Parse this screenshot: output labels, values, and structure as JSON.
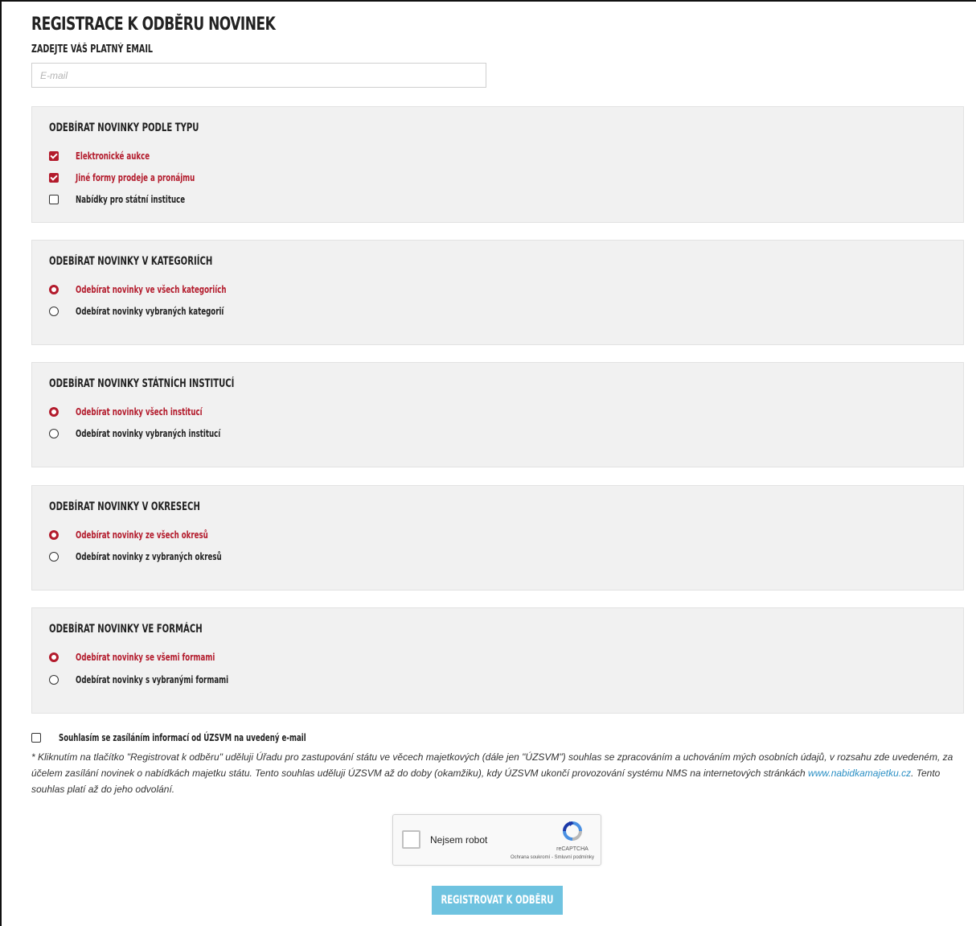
{
  "page": {
    "title": "REGISTRACE K ODBĚRU NOVINEK",
    "email_label": "ZADEJTE VÁŠ PLATNÝ EMAIL",
    "email_placeholder": "E-mail",
    "email_value": ""
  },
  "sections": [
    {
      "heading": "ODEBÍRAT NOVINKY PODLE TYPU",
      "control": "checkbox",
      "options": [
        {
          "label": "Elektronické aukce",
          "checked": true
        },
        {
          "label": "Jiné formy prodeje a pronájmu",
          "checked": true
        },
        {
          "label": "Nabídky pro státní instituce",
          "checked": false
        }
      ]
    },
    {
      "heading": "ODEBÍRAT NOVINKY V KATEGORIÍCH",
      "control": "radio",
      "options": [
        {
          "label": "Odebírat novinky ve všech kategoriích",
          "checked": true
        },
        {
          "label": "Odebírat novinky vybraných kategorií",
          "checked": false
        }
      ]
    },
    {
      "heading": "ODEBÍRAT NOVINKY STÁTNÍCH INSTITUCÍ",
      "control": "radio",
      "options": [
        {
          "label": "Odebírat novinky všech institucí",
          "checked": true
        },
        {
          "label": "Odebírat novinky vybraných institucí",
          "checked": false
        }
      ]
    },
    {
      "heading": "ODEBÍRAT NOVINKY V OKRESECH",
      "control": "radio",
      "options": [
        {
          "label": "Odebírat novinky ze všech okresů",
          "checked": true
        },
        {
          "label": "Odebírat novinky z vybraných okresů",
          "checked": false
        }
      ]
    },
    {
      "heading": "ODEBÍRAT NOVINKY VE FORMÁCH",
      "control": "radio",
      "options": [
        {
          "label": "Odebírat novinky se všemi formami",
          "checked": true
        },
        {
          "label": "Odebírat novinky s vybranými formami",
          "checked": false
        }
      ]
    }
  ],
  "consent": {
    "label": "Souhlasím se zasíláním informací od ÚZSVM na uvedený e-mail",
    "checked": false
  },
  "disclaimer": {
    "text_before_link": "* Kliknutím na tlačítko \"Registrovat k odběru\" uděluji Úřadu pro zastupování státu ve věcech majetkových (dále jen \"ÚZSVM\") souhlas se zpracováním a uchováním mých osobních údajů, v rozsahu zde uvedeném, za účelem zasílání novinek o nabídkách majetku státu. Tento souhlas uděluji ÚZSVM až do doby (okamžiku), kdy ÚZSVM ukončí provozování systému NMS na internetových stránkách ",
    "link_text": "www.nabidkamajetku.cz",
    "text_after_link": ". Tento souhlas platí až do jeho odvolání."
  },
  "captcha": {
    "label": "Nejsem robot",
    "brand": "reCAPTCHA",
    "links": "Ochrana soukromí - Smluvní podmínky",
    "icon": "recaptcha-icon"
  },
  "submit": {
    "label": "REGISTROVAT K ODBĚRU"
  },
  "colors": {
    "accent_red": "#b31b2c",
    "button_blue": "#6fc3e0",
    "link_blue": "#2a8fc4",
    "panel_bg": "#f1f1f1"
  }
}
